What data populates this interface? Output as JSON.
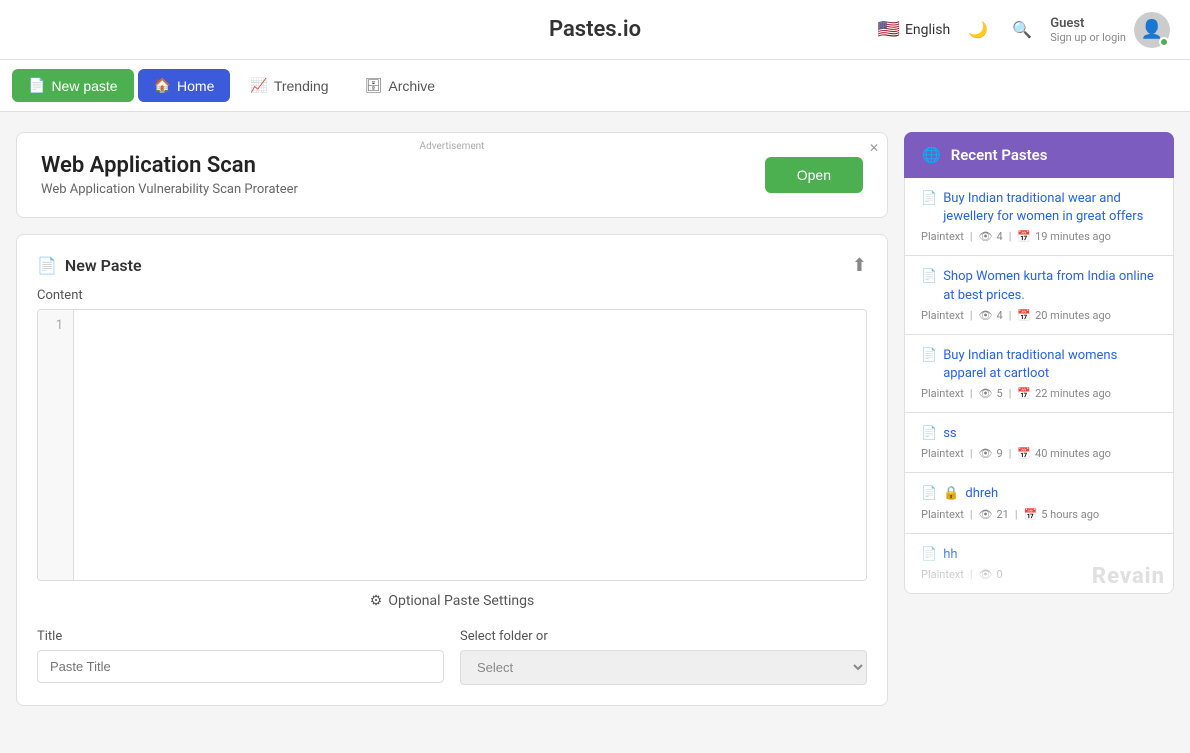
{
  "header": {
    "logo": "Pastes.io",
    "lang": "English",
    "flag": "🇺🇸",
    "theme_tooltip": "Toggle dark mode",
    "search_tooltip": "Search",
    "guest_label": "Guest",
    "guest_sub": "Sign up or login"
  },
  "nav": {
    "new_paste": "New paste",
    "home": "Home",
    "trending": "Trending",
    "archive": "Archive"
  },
  "ad": {
    "title": "Web Application Scan",
    "description": "Web Application Vulnerability Scan Prorateer",
    "open_btn": "Open",
    "label": "Advertisement"
  },
  "new_paste": {
    "title": "New Paste",
    "content_label": "Content",
    "line1": "1",
    "upload_tooltip": "Upload file",
    "optional_settings": "Optional Paste Settings",
    "title_label": "Title",
    "title_placeholder": "Paste Title",
    "folder_label": "Select folder or",
    "folder_placeholder": "Select"
  },
  "recent_pastes": {
    "header": "Recent Pastes",
    "items": [
      {
        "title": "Buy Indian traditional wear and jewellery for women in great offers",
        "type": "Plaintext",
        "views": "4",
        "time": "19 minutes ago"
      },
      {
        "title": "Shop Women kurta from India online at best prices.",
        "type": "Plaintext",
        "views": "4",
        "time": "20 minutes ago"
      },
      {
        "title": "Buy Indian traditional womens apparel at cartloot",
        "type": "Plaintext",
        "views": "5",
        "time": "22 minutes ago"
      },
      {
        "title": "ss",
        "type": "Plaintext",
        "views": "9",
        "time": "40 minutes ago"
      },
      {
        "title": "dhreh",
        "type": "Plaintext",
        "views": "21",
        "time": "5 hours ago",
        "locked": true
      },
      {
        "title": "hh",
        "type": "Plaintext",
        "views": "0",
        "time": "",
        "locked": false
      }
    ]
  }
}
